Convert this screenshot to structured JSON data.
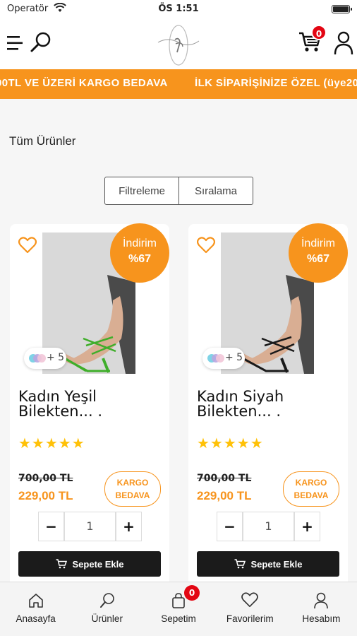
{
  "status_bar": {
    "carrier": "Operatör",
    "time": "ÖS 1:51"
  },
  "header": {
    "cart_count": "0"
  },
  "marquee": {
    "items": [
      "00TL VE ÜZERİ KARGO BEDAVA",
      "İLK SİPARİŞİNİZE ÖZEL (üye20"
    ]
  },
  "page_title": "Tüm Ürünler",
  "filter_bar": {
    "filter_label": "Filtreleme",
    "sort_label": "Sıralama"
  },
  "products": [
    {
      "discount_label": "İndirim",
      "discount_value": "%67",
      "swatch_more": "+ 5",
      "name": "Kadın Yeşil Bilekten...   .",
      "rating": 5,
      "stars": "★★★★★",
      "old_price": "700,00 TL",
      "new_price": "229,00 TL",
      "shipping_line1": "KARGO",
      "shipping_line2": "BEDAVA",
      "qty": "1",
      "minus": "−",
      "plus": "+",
      "add_to_cart": "Sepete Ekle",
      "shoe_color": "#3fae2a"
    },
    {
      "discount_label": "İndirim",
      "discount_value": "%67",
      "swatch_more": "+ 5",
      "name": "Kadın Siyah Bilekten...   .",
      "rating": 5,
      "stars": "★★★★★",
      "old_price": "700,00 TL",
      "new_price": "229,00 TL",
      "shipping_line1": "KARGO",
      "shipping_line2": "BEDAVA",
      "qty": "1",
      "minus": "−",
      "plus": "+",
      "add_to_cart": "Sepete Ekle",
      "shoe_color": "#1a1a1a"
    }
  ],
  "tabbar": {
    "items": [
      {
        "label": "Anasayfa",
        "icon": "home-icon"
      },
      {
        "label": "Ürünler",
        "icon": "search-icon"
      },
      {
        "label": "Sepetim",
        "icon": "bag-icon",
        "badge": "0"
      },
      {
        "label": "Favorilerim",
        "icon": "heart-icon"
      },
      {
        "label": "Hesabım",
        "icon": "user-icon"
      }
    ]
  },
  "colors": {
    "accent": "#f7941d",
    "badge": "#e30613",
    "dark_button": "#1b1b1b",
    "star": "#ffc107"
  }
}
